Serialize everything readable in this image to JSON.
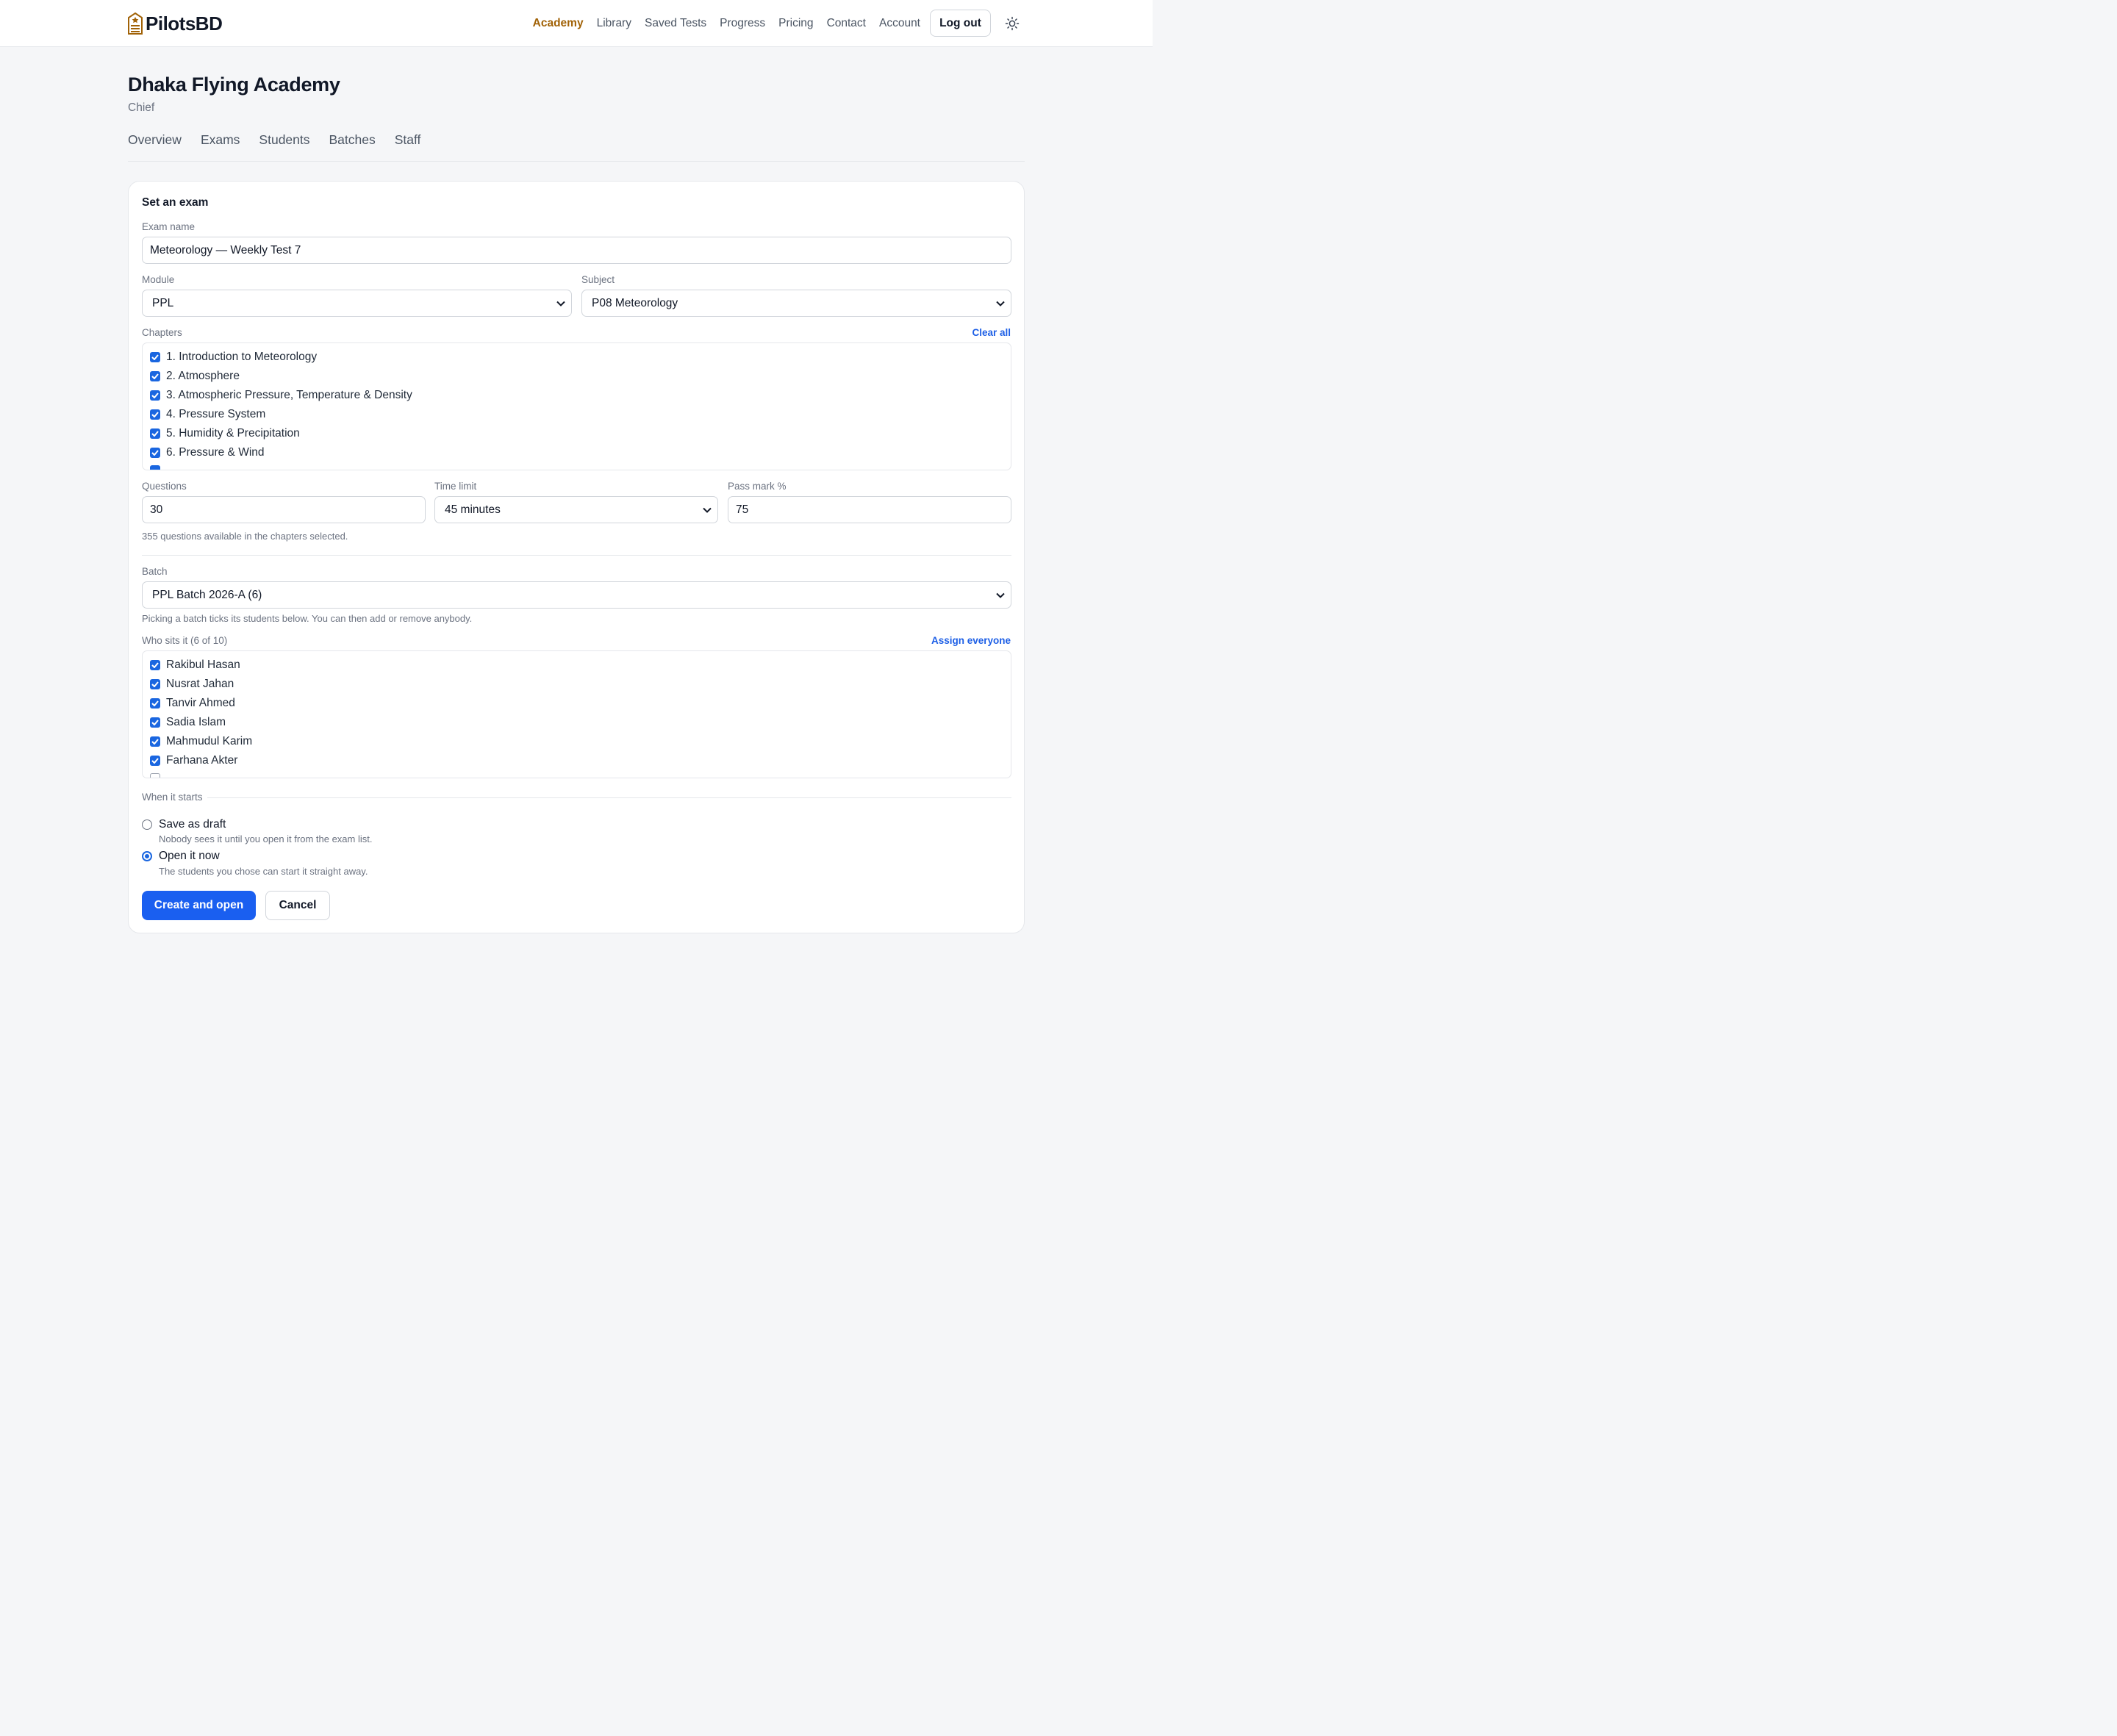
{
  "brand": {
    "name": "PilotsBD"
  },
  "nav": {
    "items": [
      "Academy",
      "Library",
      "Saved Tests",
      "Progress",
      "Pricing",
      "Contact",
      "Account"
    ],
    "active": "Academy",
    "logout_label": "Log out",
    "theme_icon": "sun-icon"
  },
  "header": {
    "title": "Dhaka Flying Academy",
    "role": "Chief",
    "tabs": [
      "Overview",
      "Exams",
      "Students",
      "Batches",
      "Staff"
    ]
  },
  "form": {
    "title": "Set an exam",
    "exam_name": {
      "label": "Exam name",
      "value": "Meteorology — Weekly Test 7"
    },
    "module": {
      "label": "Module",
      "value": "PPL"
    },
    "subject": {
      "label": "Subject",
      "value": "P08 Meteorology"
    },
    "chapters": {
      "label": "Chapters",
      "clear_label": "Clear all",
      "items": [
        {
          "label": "1. Introduction to Meteorology",
          "checked": true
        },
        {
          "label": "2. Atmosphere",
          "checked": true
        },
        {
          "label": "3. Atmospheric Pressure, Temperature & Density",
          "checked": true
        },
        {
          "label": "4. Pressure System",
          "checked": true
        },
        {
          "label": "5. Humidity & Precipitation",
          "checked": true
        },
        {
          "label": "6. Pressure & Wind",
          "checked": true
        }
      ]
    },
    "questions": {
      "label": "Questions",
      "value": "30"
    },
    "time_limit": {
      "label": "Time limit",
      "value": "45 minutes"
    },
    "pass_mark": {
      "label": "Pass mark %",
      "value": "75"
    },
    "available_note": "355 questions available in the chapters selected.",
    "batch": {
      "label": "Batch",
      "value": "PPL Batch 2026-A (6)",
      "help": "Picking a batch ticks its students below. You can then add or remove anybody."
    },
    "sitters": {
      "label": "Who sits it (6 of 10)",
      "assign_label": "Assign everyone",
      "items": [
        {
          "label": "Rakibul Hasan",
          "checked": true
        },
        {
          "label": "Nusrat Jahan",
          "checked": true
        },
        {
          "label": "Tanvir Ahmed",
          "checked": true
        },
        {
          "label": "Sadia Islam",
          "checked": true
        },
        {
          "label": "Mahmudul Karim",
          "checked": true
        },
        {
          "label": "Farhana Akter",
          "checked": true
        }
      ]
    },
    "start": {
      "label": "When it starts",
      "options": [
        {
          "label": "Save as draft",
          "help": "Nobody sees it until you open it from the exam list.",
          "selected": false
        },
        {
          "label": "Open it now",
          "help": "The students you chose can start it straight away.",
          "selected": true
        }
      ]
    },
    "submit_label": "Create and open",
    "cancel_label": "Cancel"
  },
  "colors": {
    "accent": "#1a5ff0",
    "nav_active": "#a16207"
  }
}
